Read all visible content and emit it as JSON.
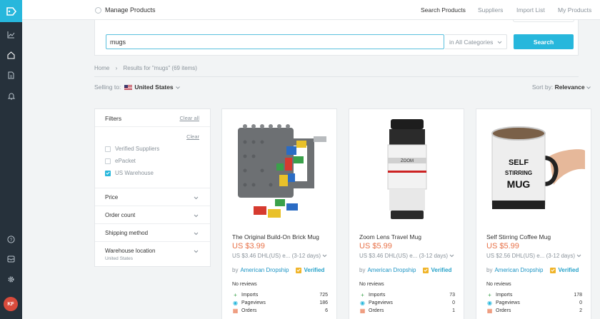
{
  "header": {
    "title": "Manage Products",
    "nav": [
      "Search Products",
      "Suppliers",
      "Import List",
      "My Products"
    ]
  },
  "user": {
    "initials": "KF"
  },
  "search": {
    "query": "mugs",
    "category": "in All Categories",
    "button": "Search"
  },
  "breadcrumb": {
    "home": "Home",
    "current": "Results for \"mugs\" (69 items)"
  },
  "selling": {
    "label": "Selling to:",
    "country": "United States"
  },
  "sort": {
    "label": "Sort by:",
    "value": "Relevance"
  },
  "filters": {
    "title": "Filters",
    "clear_all": "Clear all",
    "clear": "Clear",
    "checkboxes": [
      {
        "label": "Verified Suppliers",
        "checked": false
      },
      {
        "label": "ePacket",
        "checked": false
      },
      {
        "label": "US Warehouse",
        "checked": true
      }
    ],
    "sections": [
      "Price",
      "Order count",
      "Shipping method",
      "Warehouse location"
    ],
    "warehouse_sub": "United States"
  },
  "products": [
    {
      "name": "The Original Build-On Brick Mug",
      "price": "US $3.99",
      "shipping": "US $3.46 DHL(US) e... (3-12 days)",
      "supplier": "American Dropship",
      "verified": "Verified",
      "reviews": "No reviews",
      "stats": {
        "imports": "725",
        "pageviews": "186",
        "orders": "6"
      }
    },
    {
      "name": "Zoom Lens Travel Mug",
      "price": "US $5.99",
      "shipping": "US $3.46 DHL(US) e... (3-12 days)",
      "supplier": "American Dropship",
      "verified": "Verified",
      "reviews": "No reviews",
      "stats": {
        "imports": "73",
        "pageviews": "0",
        "orders": "1"
      }
    },
    {
      "name": "Self Stirring Coffee Mug",
      "price": "US $5.99",
      "shipping": "US $2.56 DHL(US) e... (3-12 days)",
      "supplier": "American Dropship",
      "verified": "Verified",
      "reviews": "No reviews",
      "stats": {
        "imports": "178",
        "pageviews": "0",
        "orders": "2"
      }
    }
  ],
  "labels": {
    "by": "by",
    "imports": "Imports",
    "pageviews": "Pageviews",
    "orders": "Orders"
  },
  "mug_text": {
    "lens": "ZOOM",
    "stir": [
      "SELF",
      "STIRRING",
      "MUG"
    ]
  },
  "colors": {
    "accent": "#27b7dc",
    "rail": "#26313b",
    "price": "#e8734a",
    "avatar": "#d94b3c"
  }
}
